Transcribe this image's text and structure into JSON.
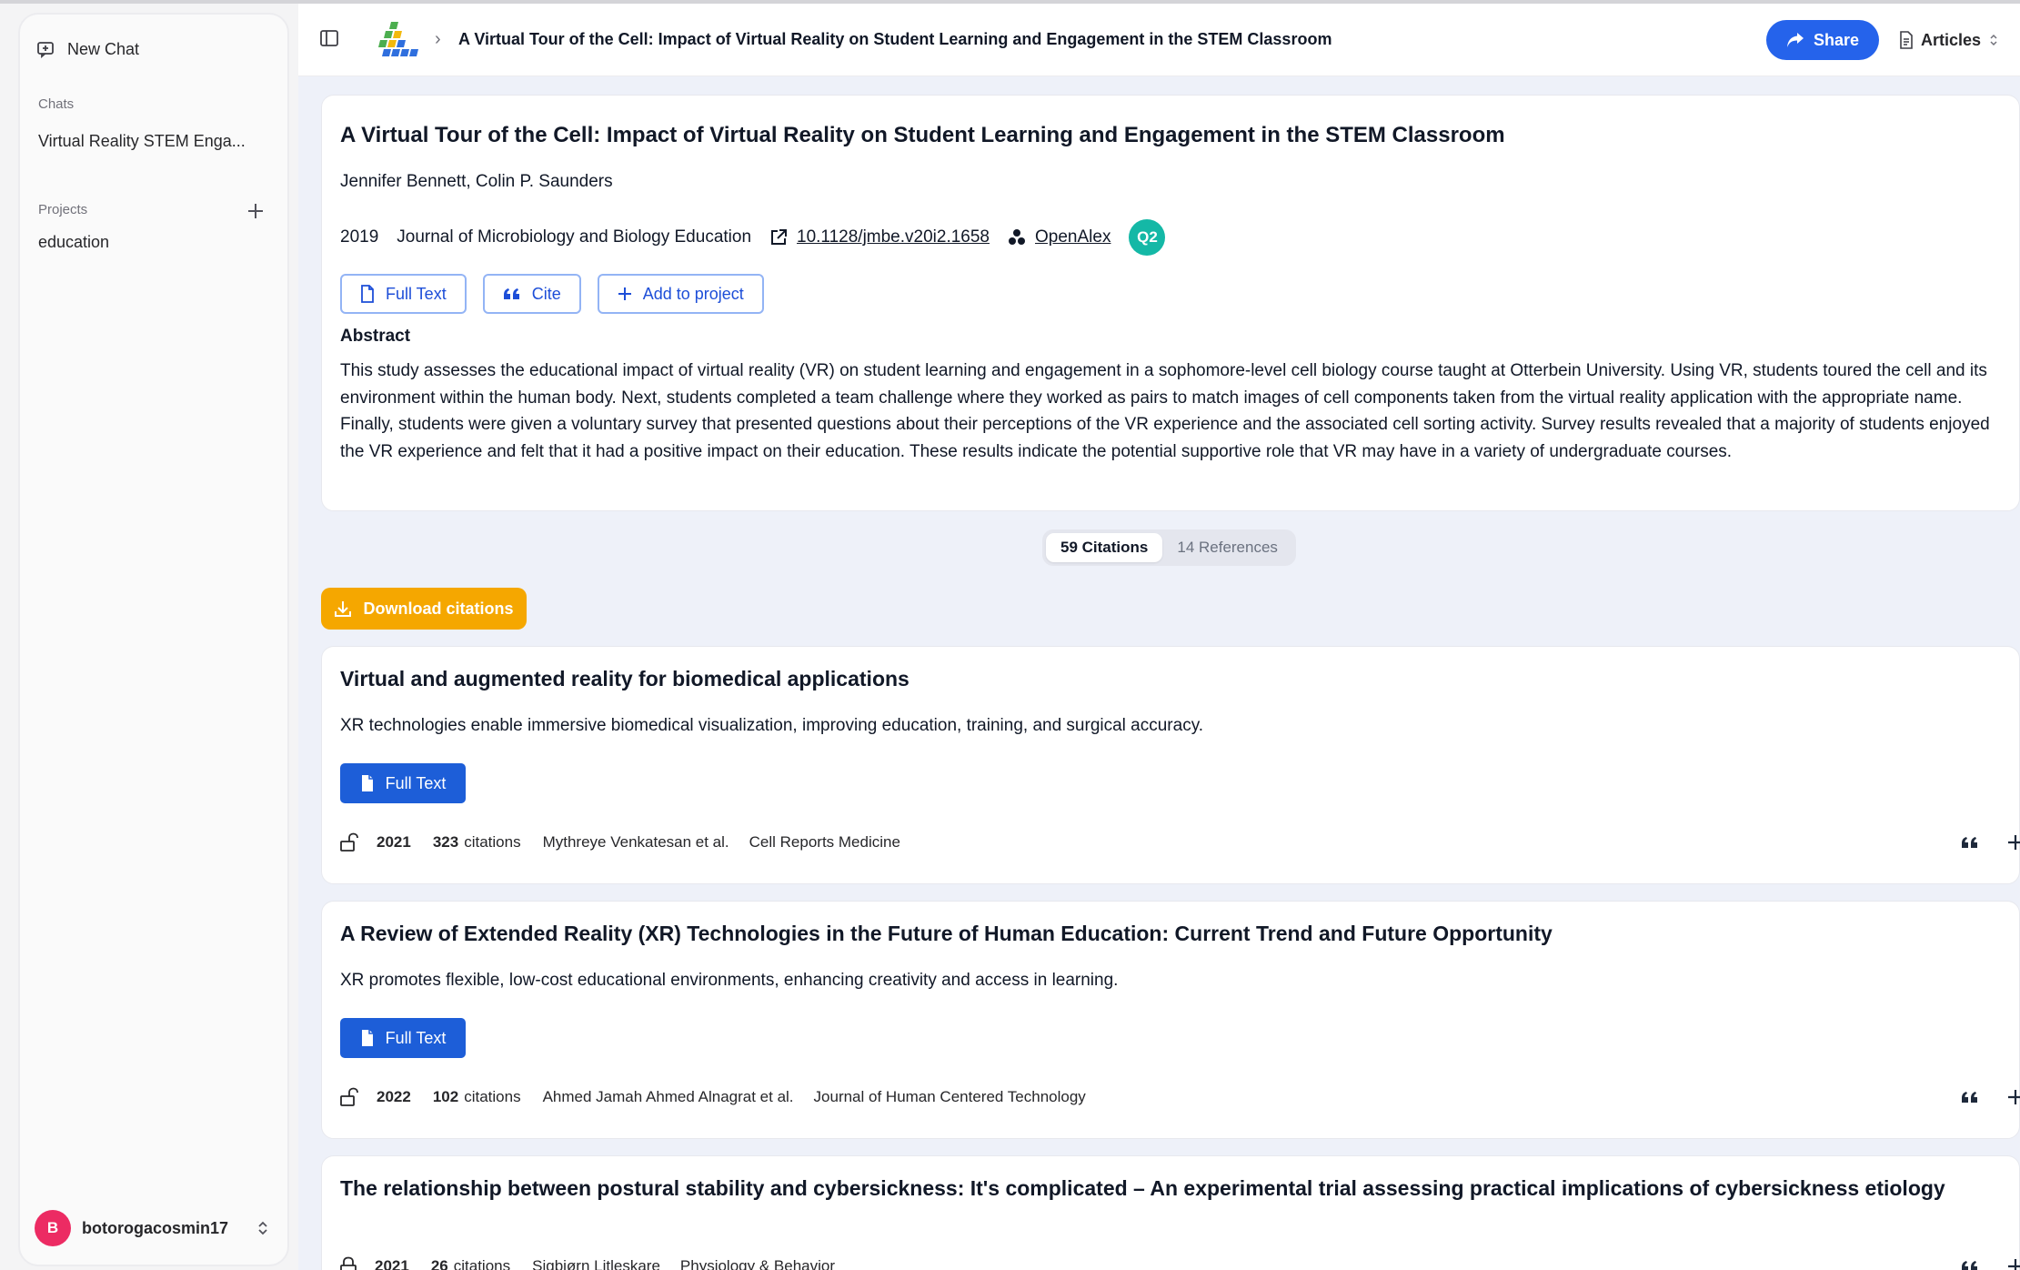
{
  "sidebar": {
    "new_chat": "New Chat",
    "chats_label": "Chats",
    "chat_item": "Virtual Reality STEM Enga...",
    "projects_label": "Projects",
    "project_item": "education",
    "user": {
      "initial": "B",
      "name": "botorogacosmin17"
    }
  },
  "header": {
    "breadcrumb_title": "A Virtual Tour of the Cell: Impact of Virtual Reality on Student Learning and Engagement in the STEM Classroom",
    "share_label": "Share",
    "articles_label": "Articles"
  },
  "paper": {
    "title": "A Virtual Tour of the Cell: Impact of Virtual Reality on Student Learning and Engagement in the STEM Classroom",
    "authors": "Jennifer Bennett, Colin P. Saunders",
    "year": "2019",
    "journal": "Journal of Microbiology and Biology Education",
    "doi": "10.1128/jmbe.v20i2.1658",
    "source": "OpenAlex",
    "quartile": "Q2",
    "buttons": {
      "full_text": "Full Text",
      "cite": "Cite",
      "add_to_project": "Add to project"
    },
    "abstract_heading": "Abstract",
    "abstract": "This study assesses the educational impact of virtual reality (VR) on student learning and engagement in a sophomore-level cell biology course taught at Otterbein University. Using VR, students toured the cell and its environment within the human body. Next, students completed a team challenge where they worked as pairs to match images of cell components taken from the virtual reality application with the appropriate name. Finally, students were given a voluntary survey that presented questions about their perceptions of the VR experience and the associated cell sorting activity. Survey results revealed that a majority of students enjoyed the VR experience and felt that it had a positive impact on their education. These results indicate the potential supportive role that VR may have in a variety of undergraduate courses."
  },
  "tabs": {
    "citations": "59 Citations",
    "references": "14 References"
  },
  "download_label": "Download citations",
  "results": [
    {
      "title": "Virtual and augmented reality for biomedical applications",
      "summary": "XR technologies enable immersive biomedical visualization, improving education, training, and surgical accuracy.",
      "full_text": "Full Text",
      "year": "2021",
      "citations": "323",
      "citations_label": "citations",
      "authors": "Mythreye Venkatesan et al.",
      "journal": "Cell Reports Medicine"
    },
    {
      "title": "A Review of Extended Reality (XR) Technologies in the Future of Human Education: Current Trend and Future Opportunity",
      "summary": "XR promotes flexible, low-cost educational environments, enhancing creativity and access in learning.",
      "full_text": "Full Text",
      "year": "2022",
      "citations": "102",
      "citations_label": "citations",
      "authors": "Ahmed Jamah Ahmed Alnagrat et al.",
      "journal": "Journal of Human Centered Technology"
    },
    {
      "title": "The relationship between postural stability and cybersickness: It's complicated – An experimental trial assessing practical implications of cybersickness etiology",
      "year": "2021",
      "citations": "26",
      "citations_label": "citations",
      "authors": "Sigbjørn Litleskare",
      "journal": "Physiology & Behavior"
    }
  ],
  "colors": {
    "primary_blue": "#2563eb",
    "download_orange": "#f5a700",
    "quartile_teal": "#14b8a6",
    "avatar_pink": "#ec2b63"
  },
  "icons": [
    "new-chat-icon",
    "plus-icon",
    "chevron-updown-icon",
    "sidebar-toggle-icon",
    "app-logo",
    "chevron-right-icon",
    "share-icon",
    "document-icon",
    "external-link-icon",
    "openalex-icon",
    "quote-icon",
    "download-icon",
    "unlock-icon",
    "lock-icon"
  ]
}
